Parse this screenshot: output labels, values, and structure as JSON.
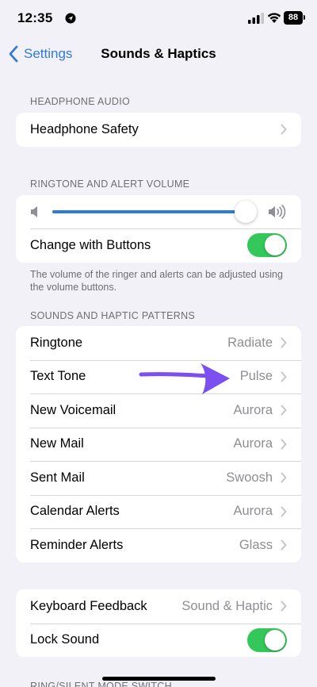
{
  "status_bar": {
    "time": "12:35",
    "battery": "88"
  },
  "nav": {
    "back_label": "Settings",
    "title": "Sounds & Haptics"
  },
  "headphone": {
    "header": "HEADPHONE AUDIO",
    "items": [
      {
        "label": "Headphone Safety"
      }
    ]
  },
  "ringtone_volume": {
    "header": "RINGTONE AND ALERT VOLUME",
    "slider_level": 1.0,
    "change_with_buttons_label": "Change with Buttons",
    "change_with_buttons_on": true,
    "footer": "The volume of the ringer and alerts can be adjusted using the volume buttons."
  },
  "patterns": {
    "header": "SOUNDS AND HAPTIC PATTERNS",
    "items": [
      {
        "label": "Ringtone",
        "value": "Radiate"
      },
      {
        "label": "Text Tone",
        "value": "Pulse"
      },
      {
        "label": "New Voicemail",
        "value": "Aurora"
      },
      {
        "label": "New Mail",
        "value": "Aurora"
      },
      {
        "label": "Sent Mail",
        "value": "Swoosh"
      },
      {
        "label": "Calendar Alerts",
        "value": "Aurora"
      },
      {
        "label": "Reminder Alerts",
        "value": "Glass"
      }
    ]
  },
  "feedback": {
    "keyboard_label": "Keyboard Feedback",
    "keyboard_value": "Sound & Haptic",
    "lock_sound_label": "Lock Sound",
    "lock_sound_on": true
  },
  "next_section_header_cut": "RING/SILENT MODE SWITCH",
  "colors": {
    "accent": "#2f7bd8",
    "toggle_on": "#34c759",
    "annotation_arrow": "#7b4ff0",
    "background": "#f2f1f7"
  }
}
